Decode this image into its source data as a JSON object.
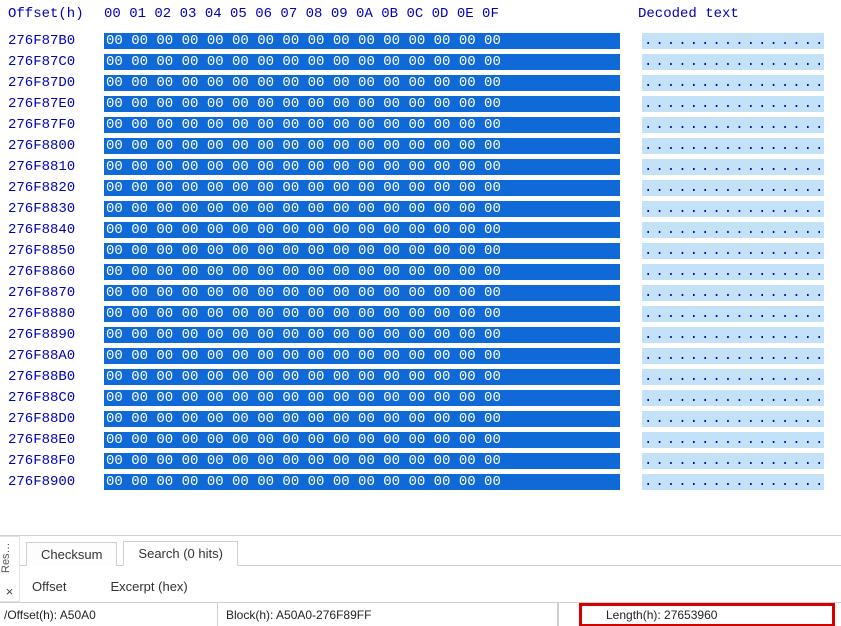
{
  "header": {
    "offset_label": "Offset(h)",
    "columns": "00 01 02 03 04 05 06 07 08 09 0A 0B 0C 0D 0E 0F",
    "decoded_label": "Decoded text"
  },
  "rows": [
    {
      "offset": "276F87B0",
      "hex": "00 00 00 00 00 00 00 00 00 00 00 00 00 00 00 00",
      "decoded": "................"
    },
    {
      "offset": "276F87C0",
      "hex": "00 00 00 00 00 00 00 00 00 00 00 00 00 00 00 00",
      "decoded": "................"
    },
    {
      "offset": "276F87D0",
      "hex": "00 00 00 00 00 00 00 00 00 00 00 00 00 00 00 00",
      "decoded": "................"
    },
    {
      "offset": "276F87E0",
      "hex": "00 00 00 00 00 00 00 00 00 00 00 00 00 00 00 00",
      "decoded": "................"
    },
    {
      "offset": "276F87F0",
      "hex": "00 00 00 00 00 00 00 00 00 00 00 00 00 00 00 00",
      "decoded": "................"
    },
    {
      "offset": "276F8800",
      "hex": "00 00 00 00 00 00 00 00 00 00 00 00 00 00 00 00",
      "decoded": "................"
    },
    {
      "offset": "276F8810",
      "hex": "00 00 00 00 00 00 00 00 00 00 00 00 00 00 00 00",
      "decoded": "................"
    },
    {
      "offset": "276F8820",
      "hex": "00 00 00 00 00 00 00 00 00 00 00 00 00 00 00 00",
      "decoded": "................"
    },
    {
      "offset": "276F8830",
      "hex": "00 00 00 00 00 00 00 00 00 00 00 00 00 00 00 00",
      "decoded": "................"
    },
    {
      "offset": "276F8840",
      "hex": "00 00 00 00 00 00 00 00 00 00 00 00 00 00 00 00",
      "decoded": "................"
    },
    {
      "offset": "276F8850",
      "hex": "00 00 00 00 00 00 00 00 00 00 00 00 00 00 00 00",
      "decoded": "................"
    },
    {
      "offset": "276F8860",
      "hex": "00 00 00 00 00 00 00 00 00 00 00 00 00 00 00 00",
      "decoded": "................"
    },
    {
      "offset": "276F8870",
      "hex": "00 00 00 00 00 00 00 00 00 00 00 00 00 00 00 00",
      "decoded": "................"
    },
    {
      "offset": "276F8880",
      "hex": "00 00 00 00 00 00 00 00 00 00 00 00 00 00 00 00",
      "decoded": "................"
    },
    {
      "offset": "276F8890",
      "hex": "00 00 00 00 00 00 00 00 00 00 00 00 00 00 00 00",
      "decoded": "................"
    },
    {
      "offset": "276F88A0",
      "hex": "00 00 00 00 00 00 00 00 00 00 00 00 00 00 00 00",
      "decoded": "................"
    },
    {
      "offset": "276F88B0",
      "hex": "00 00 00 00 00 00 00 00 00 00 00 00 00 00 00 00",
      "decoded": "................"
    },
    {
      "offset": "276F88C0",
      "hex": "00 00 00 00 00 00 00 00 00 00 00 00 00 00 00 00",
      "decoded": "................"
    },
    {
      "offset": "276F88D0",
      "hex": "00 00 00 00 00 00 00 00 00 00 00 00 00 00 00 00",
      "decoded": "................"
    },
    {
      "offset": "276F88E0",
      "hex": "00 00 00 00 00 00 00 00 00 00 00 00 00 00 00 00",
      "decoded": "................"
    },
    {
      "offset": "276F88F0",
      "hex": "00 00 00 00 00 00 00 00 00 00 00 00 00 00 00 00",
      "decoded": "................"
    },
    {
      "offset": "276F8900",
      "hex": "00 00 00 00 00 00 00 00 00 00 00 00 00 00 00 00",
      "decoded": "................"
    }
  ],
  "panel": {
    "side_tab_label": "Res…",
    "close_glyph": "×",
    "tabs": [
      {
        "label": "Checksum",
        "active": false
      },
      {
        "label": "Search (0 hits)",
        "active": true
      }
    ],
    "search": {
      "offset_label": "Offset",
      "excerpt_label": "Excerpt (hex)"
    }
  },
  "status": {
    "offset": "/Offset(h): A50A0",
    "block": "Block(h): A50A0-276F89FF",
    "length": "Length(h): 27653960"
  }
}
